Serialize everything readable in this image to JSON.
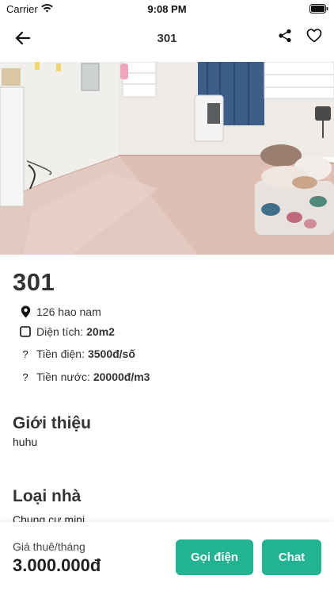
{
  "status": {
    "carrier": "Carrier",
    "time": "9:08 PM"
  },
  "nav": {
    "title": "301"
  },
  "room": {
    "title": "301",
    "address": "126 hao nam",
    "area_label": "Diện tích:",
    "area_value": "20m2",
    "electric_label": "Tiền điện:",
    "electric_value": "3500đ/số",
    "water_label": "Tiền nước:",
    "water_value": "20000đ/m3"
  },
  "intro": {
    "title": "Giới thiệu",
    "text": "huhu"
  },
  "house_type": {
    "title": "Loại nhà",
    "text": "Chung cư mini"
  },
  "footer": {
    "price_label": "Giá thuê/tháng",
    "price_value": "3.000.000đ",
    "call_label": "Gọi điện",
    "chat_label": "Chat"
  },
  "colors": {
    "accent": "#21b392"
  },
  "icons": {
    "back": "arrow-left-icon",
    "share": "share-icon",
    "favorite": "heart-icon",
    "address": "map-pin-icon",
    "area": "square-icon",
    "electric": "question-icon",
    "water": "question-icon"
  }
}
